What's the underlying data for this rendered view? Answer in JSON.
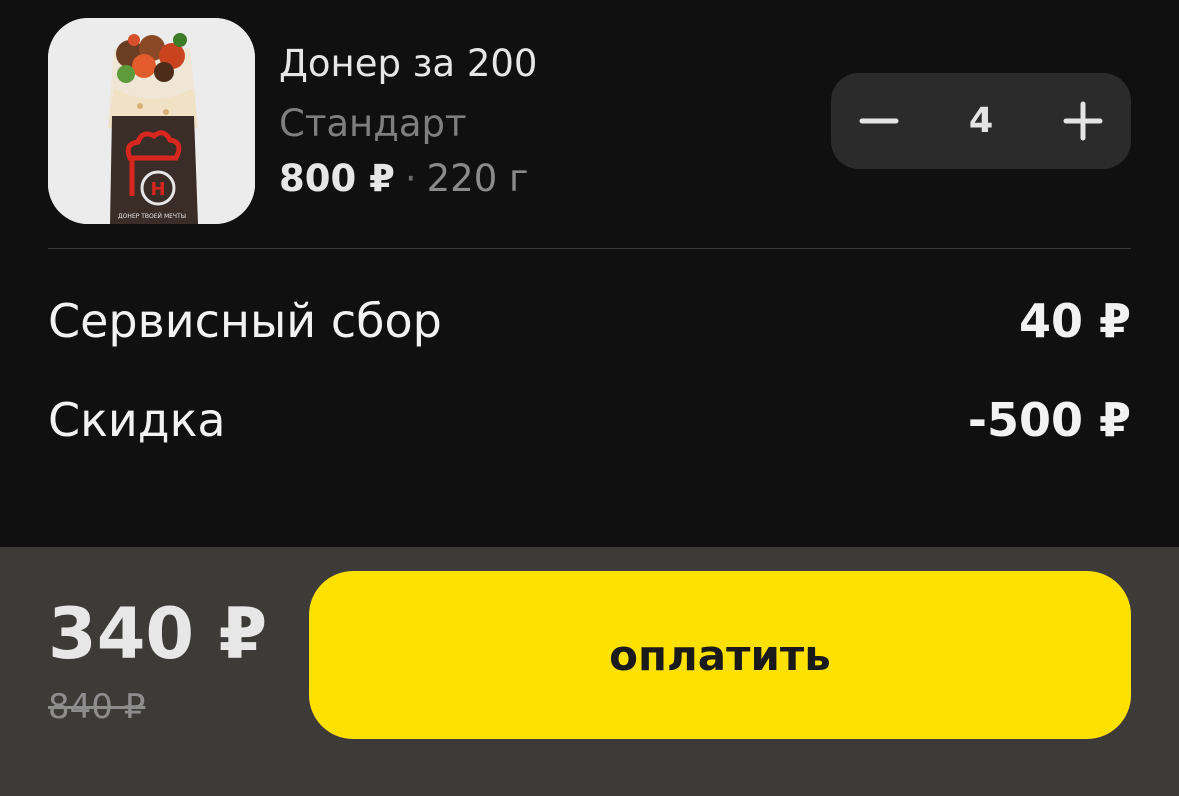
{
  "item": {
    "title": "Донер за 200",
    "variant": "Стандарт",
    "price": "800 ₽",
    "separator": "·",
    "weight": "220 г",
    "image_icon": "doner-wrap-image",
    "package_brand_lines": "ДОНЕР ТВОЕЙ МЕЧТЫ"
  },
  "stepper": {
    "quantity": "4",
    "minus_icon": "minus-icon",
    "plus_icon": "plus-icon"
  },
  "summary": {
    "service_fee_label": "Сервисный сбор",
    "service_fee_value": "40 ₽",
    "discount_label": "Скидка",
    "discount_value": "-500 ₽"
  },
  "footer": {
    "total": "340 ₽",
    "old_total": "840 ₽",
    "pay_label": "оплатить"
  },
  "colors": {
    "background": "#101010",
    "footer": "#3c3b38",
    "accent": "#ffe100",
    "stepper": "#2b2b2b",
    "brand_red": "#d7261e"
  }
}
